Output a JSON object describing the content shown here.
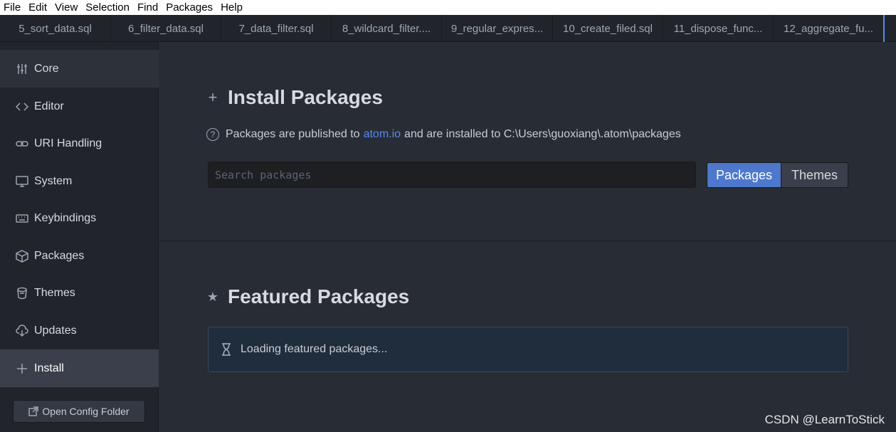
{
  "menubar": {
    "items": [
      {
        "label": "File"
      },
      {
        "label": "Edit"
      },
      {
        "label": "View"
      },
      {
        "label": "Selection"
      },
      {
        "label": "Find"
      },
      {
        "label": "Packages"
      },
      {
        "label": "Help"
      }
    ]
  },
  "tabs": [
    {
      "label": "5_sort_data.sql"
    },
    {
      "label": "6_filter_data.sql"
    },
    {
      "label": "7_data_filter.sql"
    },
    {
      "label": "8_wildcard_filter...."
    },
    {
      "label": "9_regular_expres..."
    },
    {
      "label": "10_create_filed.sql"
    },
    {
      "label": "11_dispose_func..."
    },
    {
      "label": "12_aggregate_fu..."
    }
  ],
  "sidebar": {
    "items": [
      {
        "label": "Core",
        "icon": "sliders-icon"
      },
      {
        "label": "Editor",
        "icon": "code-icon"
      },
      {
        "label": "URI Handling",
        "icon": "link-icon"
      },
      {
        "label": "System",
        "icon": "monitor-icon"
      },
      {
        "label": "Keybindings",
        "icon": "keyboard-icon"
      },
      {
        "label": "Packages",
        "icon": "package-icon"
      },
      {
        "label": "Themes",
        "icon": "paintcan-icon"
      },
      {
        "label": "Updates",
        "icon": "cloud-download-icon"
      },
      {
        "label": "Install",
        "icon": "plus-icon"
      }
    ],
    "open_config": "Open Config Folder"
  },
  "install": {
    "title": "Install Packages",
    "info_prefix": "Packages are published to",
    "info_link": "atom.io",
    "info_suffix": "and are installed to C:\\Users\\guoxiang\\.atom\\packages",
    "search_placeholder": "Search packages",
    "search_value": "",
    "btn_packages": "Packages",
    "btn_themes": "Themes"
  },
  "featured": {
    "title": "Featured Packages",
    "loading": "Loading featured packages..."
  },
  "watermark": "CSDN @LearnToStick",
  "colors": {
    "accent": "#568af2",
    "primary_button": "#4d78cc",
    "background": "#282c34",
    "sidebar": "#21252b"
  }
}
